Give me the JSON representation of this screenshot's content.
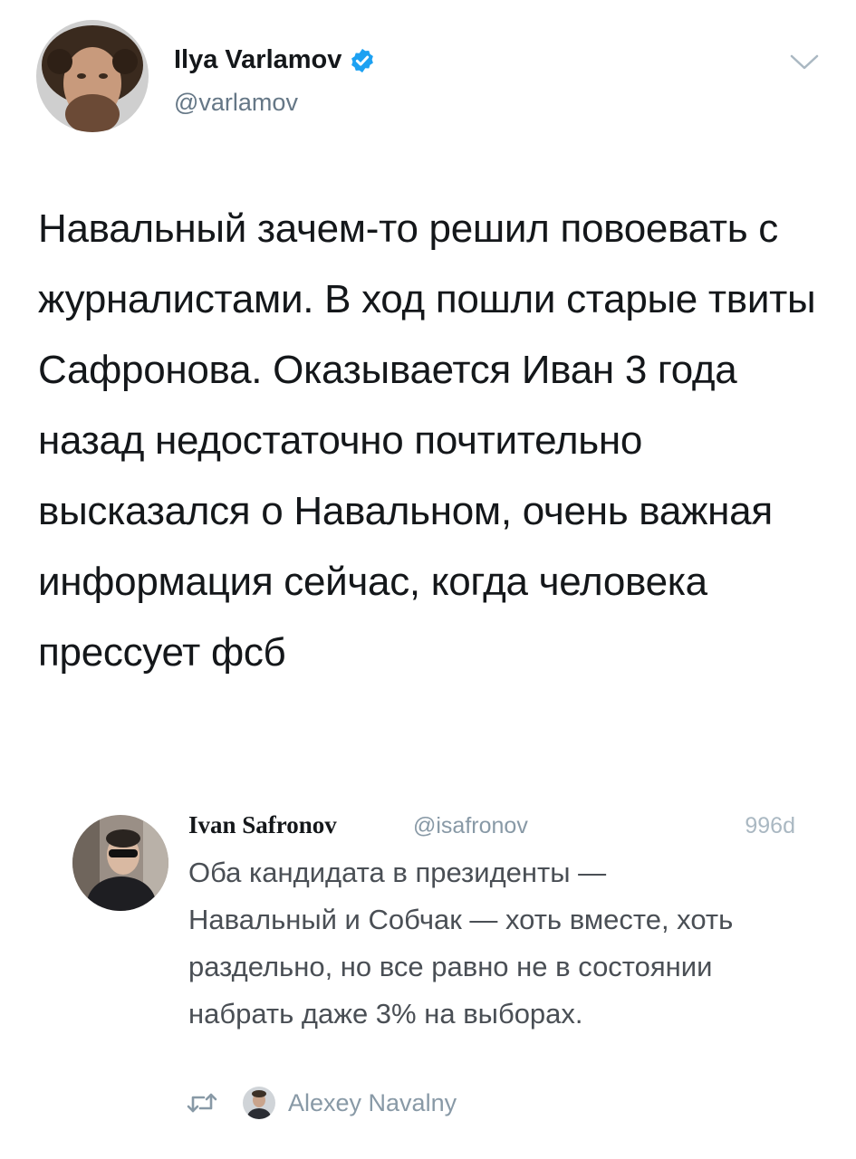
{
  "tweet": {
    "author": {
      "name": "Ilya Varlamov",
      "handle": "@varlamov",
      "verified_icon": "verified-badge-icon",
      "avatar_icon": "avatar"
    },
    "text": "Навальный зачем-то решил повоевать с журналистами. В ход пошли старые твиты Сафронова. Оказывается Иван 3 года назад недостаточно почтительно высказался о Навальном, очень важная информация сейчас, когда человека прессует фсб",
    "menu_icon": "chevron-down-icon"
  },
  "quoted_tweet": {
    "author_name": "Ivan Safronov",
    "handle": "@isafronov",
    "time": "996d",
    "text": "Оба кандидата в президенты — Навальный и Собчак — хоть вместе, хоть раздельно, но все равно не в состоянии набрать даже 3% на выборах.",
    "retweet_icon": "retweet-icon",
    "retweeted_by": "Alexey Navalny"
  },
  "colors": {
    "text_primary": "#14171a",
    "text_secondary": "#657786",
    "verified": "#1da1f2",
    "muted": "#aab8c2"
  }
}
